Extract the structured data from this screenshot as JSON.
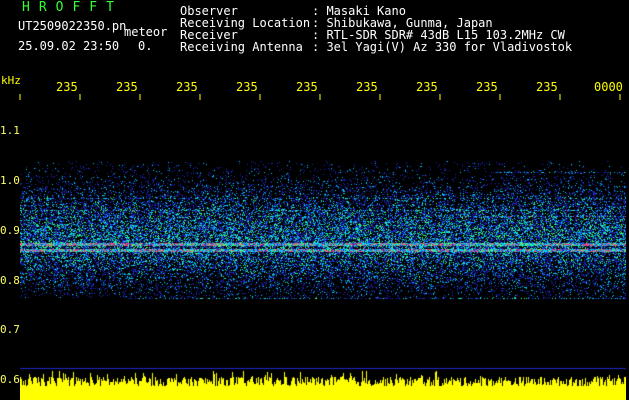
{
  "header": {
    "logo": "HROFFT",
    "filename": "UT2509022350.pn",
    "mode": "meteor",
    "datetime": "25.09.02 23:50",
    "count": "0."
  },
  "info": {
    "observer_label": "Observer",
    "observer_value": ": Masaki Kano",
    "location_label": "Receiving Location",
    "location_value": ": Shibukawa, Gunma, Japan",
    "receiver_label": "Receiver",
    "receiver_value": ": RTL-SDR SDR# 43dB L15 103.2MHz CW",
    "antenna_label": "Receiving Antenna",
    "antenna_value": ": 3el Yagi(V) Az 330 for Vladivostok"
  },
  "axis": {
    "unit": "kHz",
    "y_ticks": [
      "1.1",
      "1.0",
      "0.9",
      "0.8",
      "0.7",
      "0.6"
    ],
    "x_ticks": [
      "235",
      "235",
      "235",
      "235",
      "235",
      "235",
      "235",
      "235",
      "235",
      "0000"
    ]
  },
  "colors": {
    "background": "#000000",
    "label_yellow": "#ffff00",
    "logo_green": "#33ff33",
    "signal_low": "#1e28c8",
    "signal_mid": "#00c8ff",
    "signal_high": "#ff3070",
    "noise_bar": "#ffff00"
  }
}
